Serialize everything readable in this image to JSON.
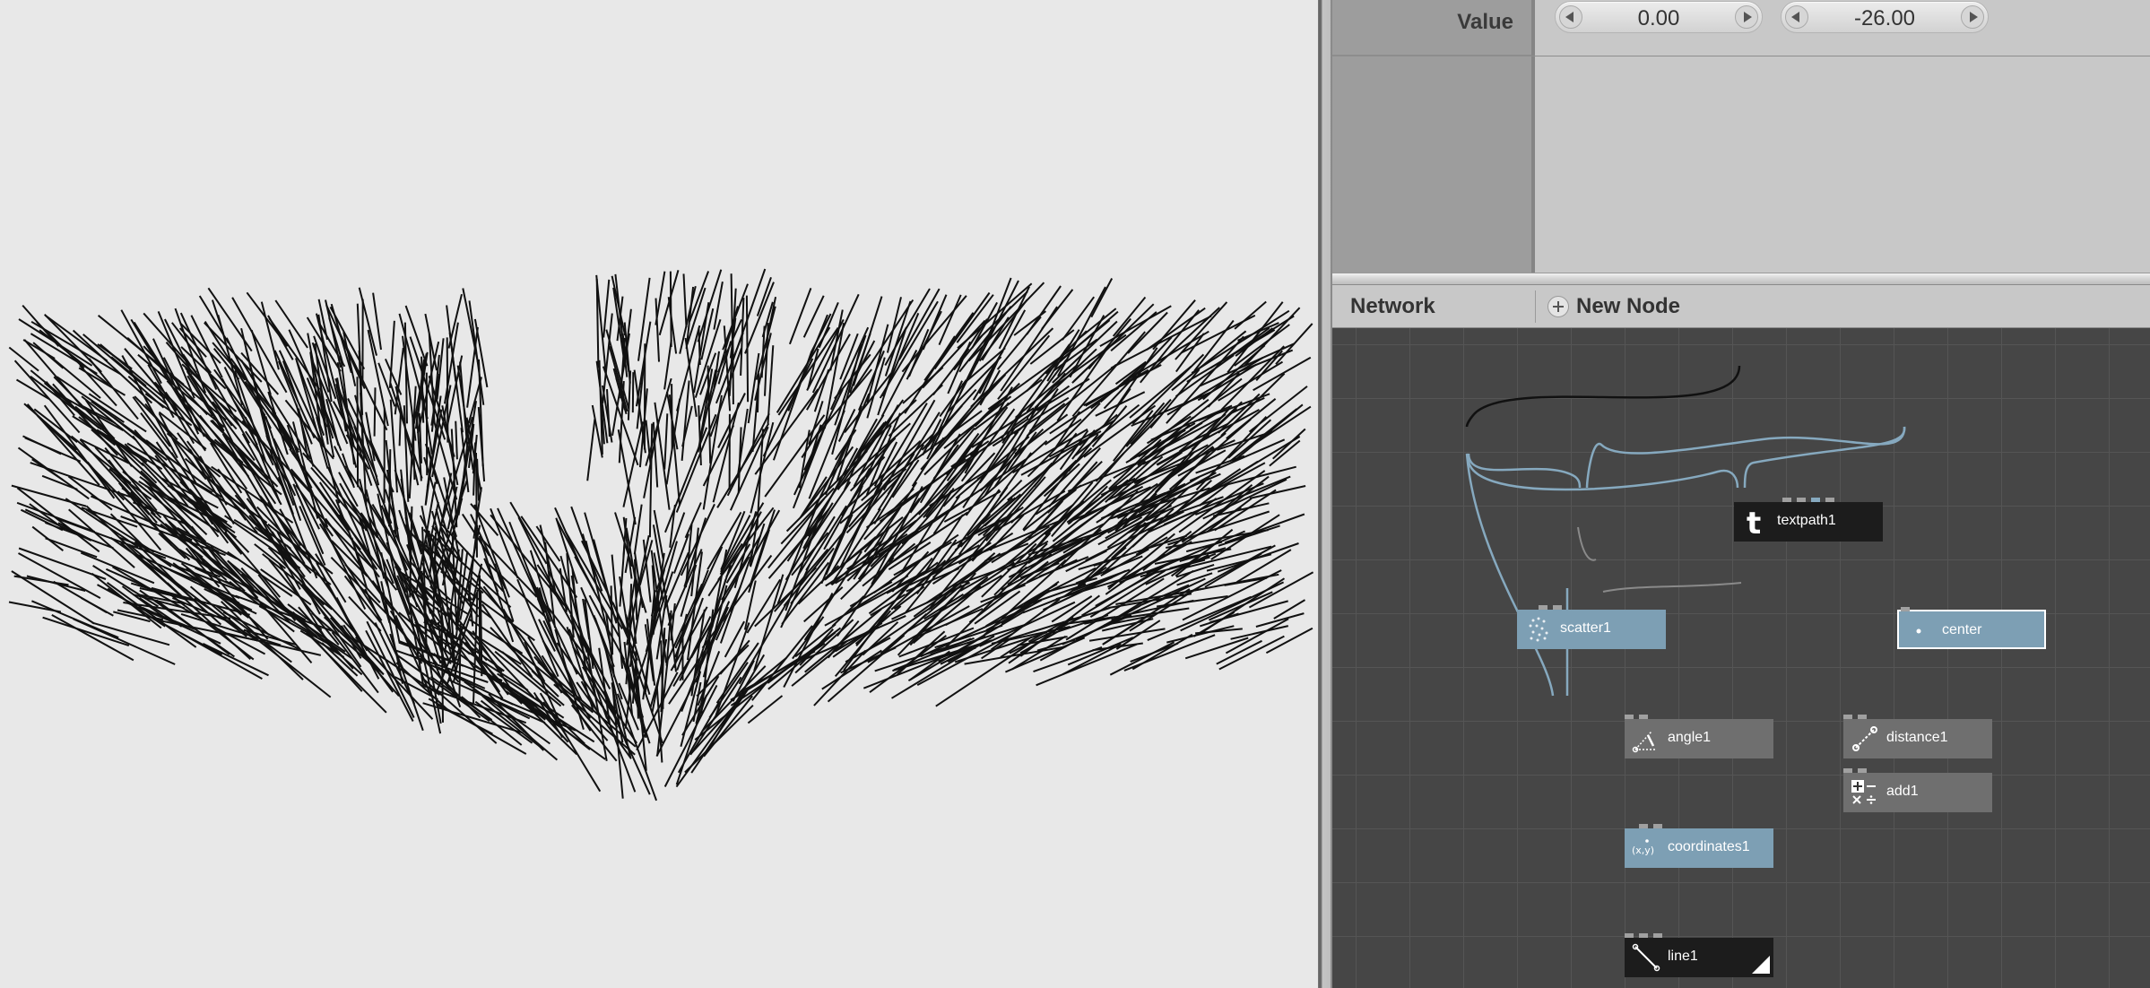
{
  "viewer": {
    "stroke_color": "#111111",
    "background": "#e8e8e8"
  },
  "parameters": {
    "row_label": "Value",
    "x_value": "0.00",
    "y_value": "-26.00"
  },
  "network": {
    "title": "Network",
    "new_node_label": "New Node",
    "nodes": {
      "textpath": "textpath1",
      "scatter": "scatter1",
      "center": "center",
      "angle": "angle1",
      "distance": "distance1",
      "add": "add1",
      "coordinates": "coordinates1",
      "line": "line1"
    },
    "colors": {
      "canvas": "#464646",
      "node_blue": "#7d9fb4",
      "node_gray": "#6f6f6f",
      "node_black": "#1c1c1c",
      "wire_blue": "#86a9bf",
      "wire_gray": "#8a8a8a",
      "wire_black": "#111111"
    }
  }
}
